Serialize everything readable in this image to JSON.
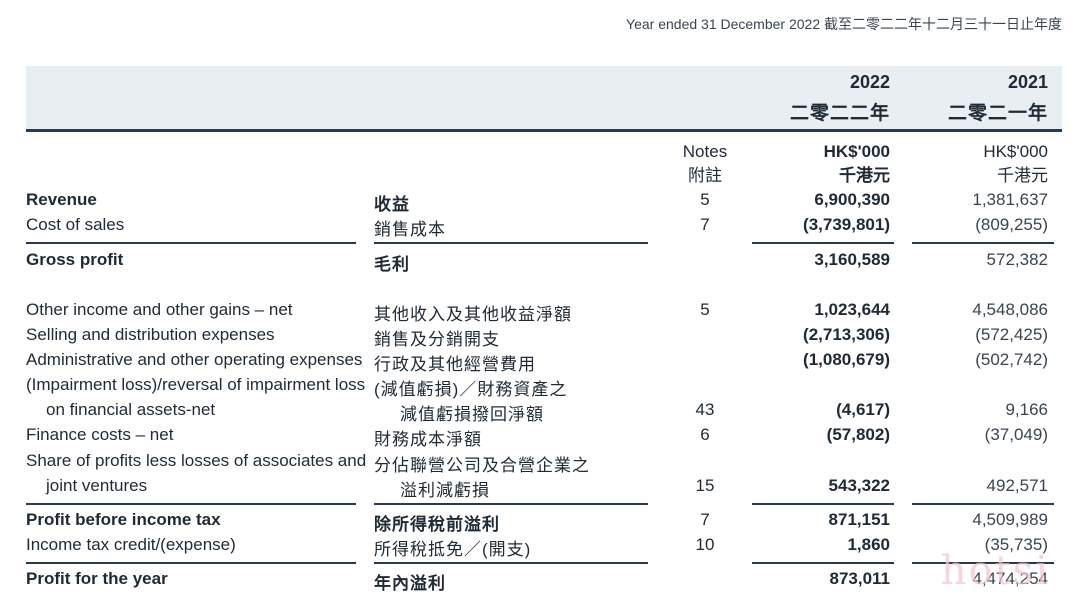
{
  "period_label": "Year ended 31 December 2022 截至二零二二年十二月三十一日止年度",
  "columns": {
    "y2022": "2022",
    "y2022_cn": "二零二二年",
    "y2021": "2021",
    "y2021_cn": "二零二一年",
    "notes_en": "Notes",
    "notes_cn": "附註",
    "unit_en": "HK$'000",
    "unit_cn": "千港元"
  },
  "rows": [
    {
      "en": "Revenue",
      "cn": "收益",
      "note": "5",
      "v2022": "6,900,390",
      "v2021": "1,381,637"
    },
    {
      "en": "Cost of sales",
      "cn": "銷售成本",
      "note": "7",
      "v2022": "(3,739,801)",
      "v2021": "(809,255)"
    },
    {
      "en": "Gross profit",
      "cn": "毛利",
      "note": "",
      "v2022": "3,160,589",
      "v2021": "572,382"
    },
    {
      "en": "Other income and other gains – net",
      "cn": "其他收入及其他收益淨額",
      "note": "5",
      "v2022": "1,023,644",
      "v2021": "4,548,086"
    },
    {
      "en": "Selling and distribution expenses",
      "cn": "銷售及分銷開支",
      "note": "",
      "v2022": "(2,713,306)",
      "v2021": "(572,425)"
    },
    {
      "en": "Administrative and other operating expenses",
      "cn": "行政及其他經營費用",
      "note": "",
      "v2022": "(1,080,679)",
      "v2021": "(502,742)"
    },
    {
      "en": "(Impairment loss)/reversal of impairment loss",
      "cn": "(減值虧損)／財務資產之",
      "note": "",
      "v2022": "",
      "v2021": ""
    },
    {
      "en": "on financial assets-net",
      "cn": "減值虧損撥回淨額",
      "note": "43",
      "v2022": "(4,617)",
      "v2021": "9,166"
    },
    {
      "en": "Finance costs – net",
      "cn": "財務成本淨額",
      "note": "6",
      "v2022": "(57,802)",
      "v2021": "(37,049)"
    },
    {
      "en": "Share of profits less losses of associates and",
      "cn": "分佔聯營公司及合營企業之",
      "note": "",
      "v2022": "",
      "v2021": ""
    },
    {
      "en": "joint ventures",
      "cn": "溢利減虧損",
      "note": "15",
      "v2022": "543,322",
      "v2021": "492,571"
    },
    {
      "en": "Profit before income tax",
      "cn": "除所得稅前溢利",
      "note": "7",
      "v2022": "871,151",
      "v2021": "4,509,989"
    },
    {
      "en": "Income tax credit/(expense)",
      "cn": "所得稅抵免／(開支)",
      "note": "10",
      "v2022": "1,860",
      "v2021": "(35,735)"
    },
    {
      "en": "Profit for the year",
      "cn": "年內溢利",
      "note": "",
      "v2022": "873,011",
      "v2021": "4,474,254"
    }
  ],
  "watermark": "hotsi"
}
